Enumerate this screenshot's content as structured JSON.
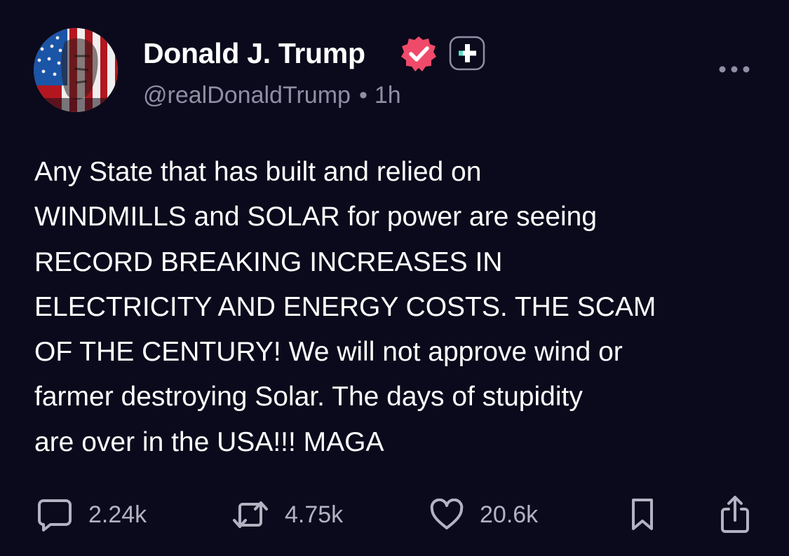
{
  "post": {
    "author": {
      "display_name": "Donald J. Trump",
      "handle": "@realDonaldTrump",
      "timestamp": "1h",
      "verified": true,
      "avatar_icon": "flag-portrait-avatar",
      "badge_icons": [
        "verified-check-icon",
        "plus-badge-icon"
      ]
    },
    "body_lines": [
      "Any State that has built and relied on",
      "WINDMILLS and SOLAR for power are seeing",
      "RECORD BREAKING INCREASES IN",
      "ELECTRICITY AND ENERGY COSTS. THE SCAM",
      "OF THE CENTURY! We will not approve wind or",
      "farmer destroying Solar. The days of stupidity",
      "are over in the USA!!! MAGA"
    ],
    "separator": "•",
    "actions": {
      "replies": "2.24k",
      "reposts": "4.75k",
      "likes": "20.6k"
    },
    "action_icons": [
      "reply-icon",
      "repost-icon",
      "like-icon",
      "bookmark-icon",
      "share-icon"
    ]
  },
  "colors": {
    "background": "#0b0a1c",
    "text_primary": "#ffffff",
    "text_secondary": "#8f8ea3",
    "icon_muted": "#b3b2c2",
    "verified_badge": "#f04a6a",
    "plus_badge_accent": "#5ce1c8"
  }
}
